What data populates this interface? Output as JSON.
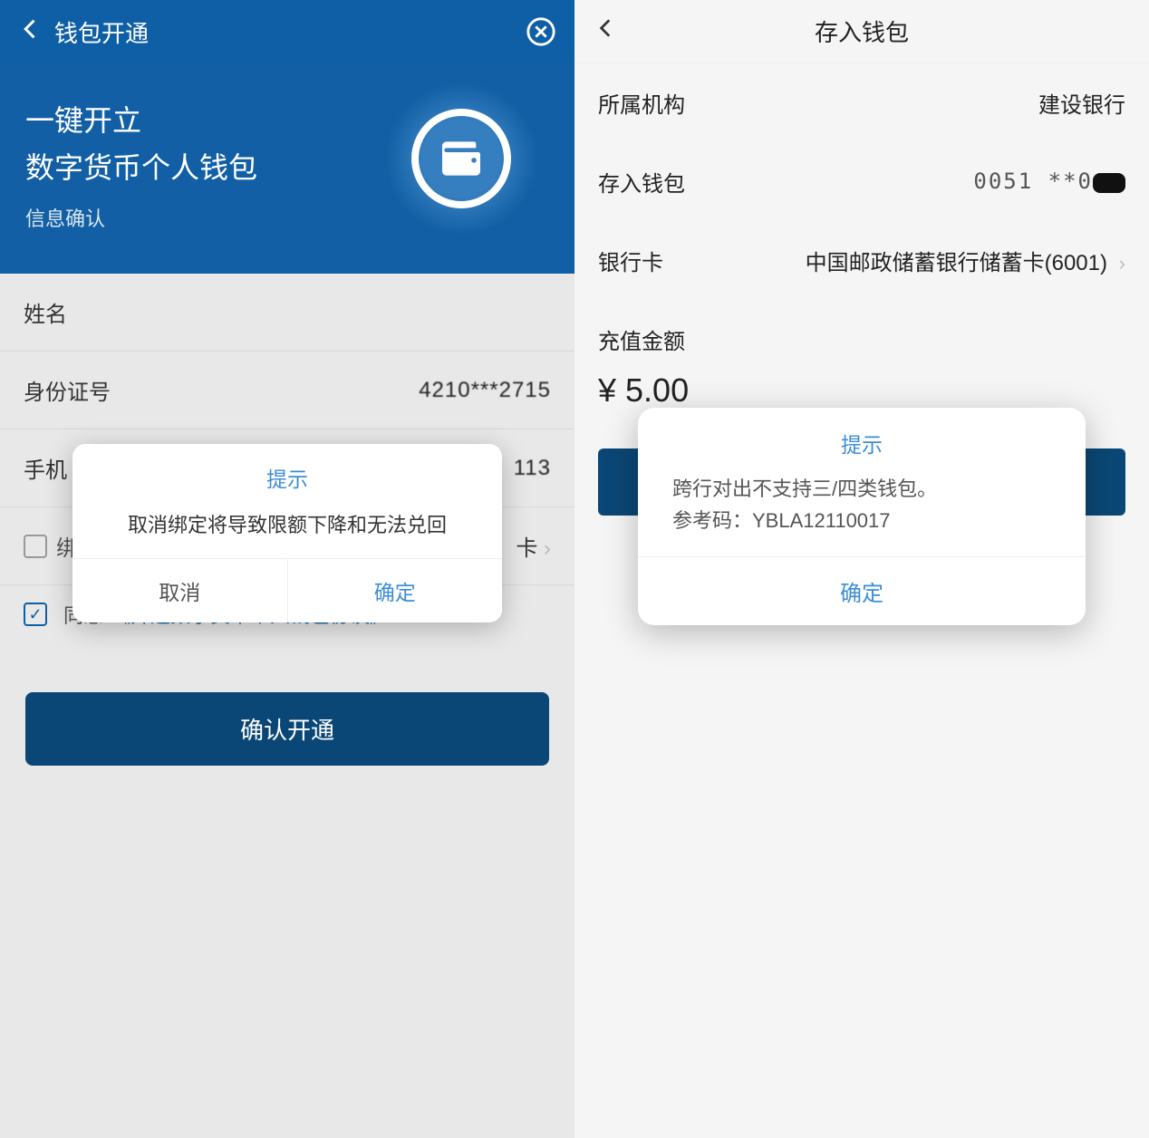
{
  "left": {
    "header": {
      "title": "钱包开通"
    },
    "hero": {
      "line1": "一键开立",
      "line2": "数字货币个人钱包",
      "subtitle": "信息确认"
    },
    "form": {
      "name_label": "姓名",
      "id_label": "身份证号",
      "id_value": "4210***2715",
      "phone_label": "手机",
      "phone_tail": "113",
      "bind_label": "绑",
      "bind_tail": "卡"
    },
    "agreement": {
      "agree_text": "同意",
      "link_text": "《开通数字货币个人钱包协议》"
    },
    "confirm_button": "确认开通",
    "dialog": {
      "title": "提示",
      "body": "取消绑定将导致限额下降和无法兑回",
      "cancel": "取消",
      "confirm": "确定"
    }
  },
  "right": {
    "header": {
      "title": "存入钱包"
    },
    "rows": {
      "org_label": "所属机构",
      "org_value": "建设银行",
      "wallet_label": "存入钱包",
      "wallet_value": "0051 **0",
      "bank_label": "银行卡",
      "bank_value": "中国邮政储蓄银行储蓄卡(6001)"
    },
    "amount": {
      "label": "充值金额",
      "value": "¥ 5.00"
    },
    "dialog": {
      "title": "提示",
      "body_line1": "跨行对出不支持三/四类钱包。",
      "body_line2": "参考码：YBLA12110017",
      "confirm": "确定"
    }
  }
}
